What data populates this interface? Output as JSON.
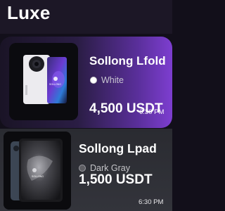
{
  "header": {
    "title": "Luxe"
  },
  "products": [
    {
      "name": "Sollong Lfold",
      "color_name": "White",
      "price": "4,500 USDT",
      "time": "6:30 PM"
    },
    {
      "name": "Sollong Lpad",
      "color_name": "Dark Gray",
      "price": "1,500 USDT",
      "time": "6:30 PM"
    }
  ],
  "device_branding": "SOLLONG",
  "colors": {
    "accent": "#7d3ed0",
    "background": "#120f1a"
  }
}
